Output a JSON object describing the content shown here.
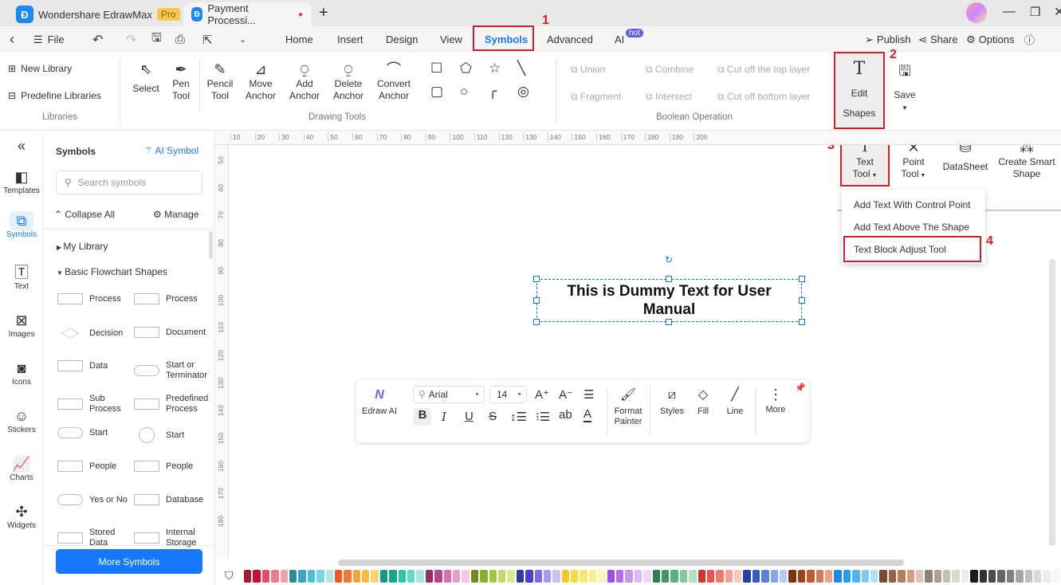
{
  "titlebar": {
    "app_name": "Wondershare EdrawMax",
    "pro_badge": "Pro",
    "doc_tab": "Payment Processi...",
    "new_tab": "+"
  },
  "menubar": {
    "file": "File",
    "tabs": [
      "Home",
      "Insert",
      "Design",
      "View",
      "Symbols",
      "Advanced",
      "AI"
    ],
    "active_tab": "Symbols",
    "ai_badge": "hot",
    "publish": "Publish",
    "share": "Share",
    "options": "Options"
  },
  "ribbon": {
    "libraries": {
      "new_library": "New Library",
      "predefine": "Predefine Libraries",
      "group": "Libraries"
    },
    "drawing": {
      "tools": [
        [
          "Select",
          ""
        ],
        [
          "Pen",
          "Tool"
        ],
        [
          "Pencil",
          "Tool"
        ],
        [
          "Move",
          "Anchor"
        ],
        [
          "Add",
          "Anchor"
        ],
        [
          "Delete",
          "Anchor"
        ],
        [
          "Convert",
          "Anchor"
        ]
      ],
      "group": "Drawing Tools"
    },
    "boolean": {
      "items": [
        "Union",
        "Combine",
        "Cut off the top layer",
        "Fragment",
        "Intersect",
        "Cut off bottom layer"
      ],
      "group": "Boolean Operation"
    },
    "edit_shapes": [
      "Edit",
      "Shapes"
    ],
    "save": "Save",
    "row2": {
      "text_tool": [
        "Text",
        "Tool"
      ],
      "point_tool": [
        "Point",
        "Tool"
      ],
      "datasheet": "DataSheet",
      "smart_shape": [
        "Create Smart",
        "Shape"
      ]
    }
  },
  "dropdown": [
    "Add Text With Control Point",
    "Add Text Above The Shape",
    "Text Block Adjust Tool"
  ],
  "annotations": [
    "1",
    "2",
    "3",
    "4"
  ],
  "leftbar": [
    "Templates",
    "Symbols",
    "Text",
    "Images",
    "Icons",
    "Stickers",
    "Charts",
    "Widgets"
  ],
  "panel": {
    "title": "Symbols",
    "ai_symbol": "AI Symbol",
    "search_placeholder": "Search symbols",
    "collapse_all": "Collapse All",
    "manage": "Manage",
    "my_library": "My Library",
    "section": "Basic Flowchart Shapes",
    "shapes": [
      [
        "Process",
        "Process"
      ],
      [
        "Decision",
        "Document"
      ],
      [
        "Data",
        "Start or Terminator"
      ],
      [
        "Sub Process",
        "Predefined Process"
      ],
      [
        "Start",
        "Start"
      ],
      [
        "People",
        "People"
      ],
      [
        "Yes or No",
        "Database"
      ],
      [
        "Stored Data",
        "Internal Storage"
      ]
    ],
    "more_symbols": "More Symbols"
  },
  "ruler_top": [
    "10",
    "20",
    "30",
    "40",
    "50",
    "60",
    "70",
    "80",
    "90",
    "100",
    "110",
    "120",
    "130",
    "140",
    "150",
    "160",
    "170",
    "180",
    "190",
    "200"
  ],
  "ruler_left": [
    "50",
    "60",
    "70",
    "80",
    "90",
    "100",
    "110",
    "120",
    "130",
    "140",
    "150",
    "160",
    "170",
    "180"
  ],
  "canvas": {
    "text": "This is Dummy Text for User Manual"
  },
  "floatbar": {
    "edraw_ai": "Edraw AI",
    "font": "Arial",
    "size": "14",
    "format_painter": [
      "Format",
      "Painter"
    ],
    "styles": "Styles",
    "fill": "Fill",
    "line": "Line",
    "more": "More"
  },
  "colors": {
    "accent": "#1677ff",
    "annotation": "#d0202a",
    "palette": [
      "#a51c30",
      "#c8102e",
      "#e0506a",
      "#ee7c8e",
      "#f2a0ae",
      "#2e8b9a",
      "#3aa7b8",
      "#4fc0d0",
      "#7dd3df",
      "#b3e6ee",
      "#ee5a24",
      "#f0792e",
      "#f7a23b",
      "#fbbc3c",
      "#fcd56c",
      "#11998e",
      "#16a88f",
      "#2cc6a8",
      "#64d8c0",
      "#a3e8da",
      "#8e2d6a",
      "#b7478b",
      "#d96fae",
      "#ec9ccb",
      "#f5c6e0",
      "#6b8e23",
      "#8aae2f",
      "#a8c43f",
      "#c2d86a",
      "#dbe79e",
      "#2c3e9e",
      "#4a3fd0",
      "#7f6ae8",
      "#a89af0",
      "#c9c0f7",
      "#f8c81e",
      "#fbd743",
      "#f7e86a",
      "#f9f08f",
      "#fcf6b8",
      "#9b51e0",
      "#b36ff0",
      "#c996f3",
      "#dcb8f7",
      "#ecd7fa",
      "#2e7d4f",
      "#3e9b62",
      "#58b07a",
      "#85c99e",
      "#b4e0c2",
      "#d63031",
      "#e8524f",
      "#f07a6f",
      "#f5a196",
      "#f9c6bd",
      "#2441a4",
      "#3a5bc7",
      "#5b7ee0",
      "#89a4ec",
      "#b8c9f5",
      "#7a3410",
      "#9c4418",
      "#c05a2c",
      "#d9795a",
      "#e9a38d",
      "#1e88e5",
      "#2a9de8",
      "#4fb4ef",
      "#7ecbf4",
      "#b1e0fa",
      "#7b4a30",
      "#9a6044",
      "#b87c5e",
      "#d19d83",
      "#e6c2b0",
      "#8d8478",
      "#aba295",
      "#c6bfb3",
      "#ddd8cf",
      "#eeebe6",
      "#1c1c1c",
      "#333333",
      "#4d4d4d",
      "#666666",
      "#808080",
      "#a6a6a6",
      "#c0c0c0",
      "#d9d9d9",
      "#ececec",
      "#f7f7f7"
    ]
  }
}
